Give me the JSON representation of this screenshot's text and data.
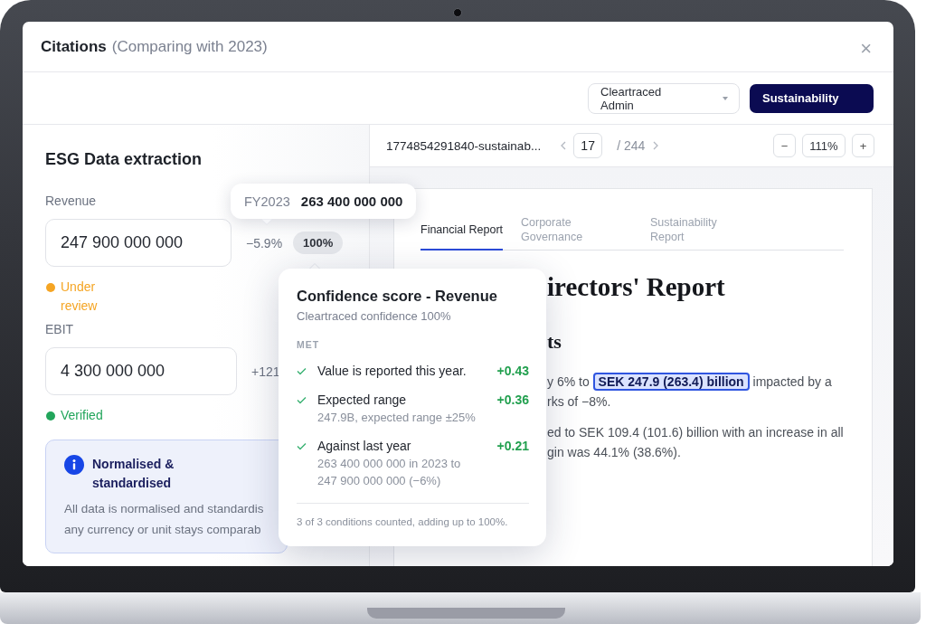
{
  "dialog": {
    "title": "Citations",
    "subtitle": "(Comparing with 2023)",
    "close": "×"
  },
  "toolbar": {
    "account_select": {
      "value": "Cleartraced Admin"
    },
    "pdf_button": {
      "label": "Sustainability"
    }
  },
  "extraction": {
    "heading": "ESG Data extraction",
    "fields": [
      {
        "label": "Revenue",
        "value": "247 900 000 000",
        "change": "−5.9%",
        "confidence": "100%",
        "status": {
          "label": "Under review",
          "color": "#f5a524"
        }
      },
      {
        "label": "EBIT",
        "value": "4 300 000 000",
        "change": "+121",
        "status": {
          "label": "Verified",
          "color": "#22a55b"
        }
      }
    ],
    "info": {
      "title": "Normalised & standardised",
      "body": "All data is normalised and standardis\nany currency or unit stays comparab"
    }
  },
  "comparison_tooltip": {
    "period": "FY2023",
    "value": "263 400 000 000"
  },
  "confidence_popover": {
    "title": "Confidence score - Revenue",
    "subtitle": "Cleartraced confidence 100%",
    "section": "MET",
    "conditions": [
      {
        "label": "Value is reported this year.",
        "score": "+0.43"
      },
      {
        "label": "Expected range",
        "detail": "247.9B, expected range ±25%",
        "score": "+0.36"
      },
      {
        "label": "Against last year",
        "detail": "263 400 000 000 in 2023 to\n247 900 000 000 (−6%)",
        "score": "+0.21"
      }
    ],
    "footer": "3 of 3 conditions counted, adding up to 100%."
  },
  "viewer": {
    "file_name": "1774854291840-sustainab...",
    "page": "17",
    "page_count": "/ 244",
    "zoom_out": "−",
    "zoom": "111%",
    "zoom_in": "+",
    "tabs": [
      {
        "label": "Financial Report",
        "selected": true
      },
      {
        "label": "Corporate Governance",
        "selected": false
      },
      {
        "label": "Sustainability Report",
        "selected": false
      }
    ],
    "heading": "irectors' Report",
    "subheading": "ts",
    "paragraphs": [
      {
        "before": "y 6% to",
        "highlight": "SEK 247.9 (263.4) billion",
        "after": "impacted by a\nrks of −8%."
      },
      {
        "before": "ed to SEK 109.4 (101.6) billion with an increase in all\ngin was 44.1% (38.6%)."
      }
    ]
  }
}
